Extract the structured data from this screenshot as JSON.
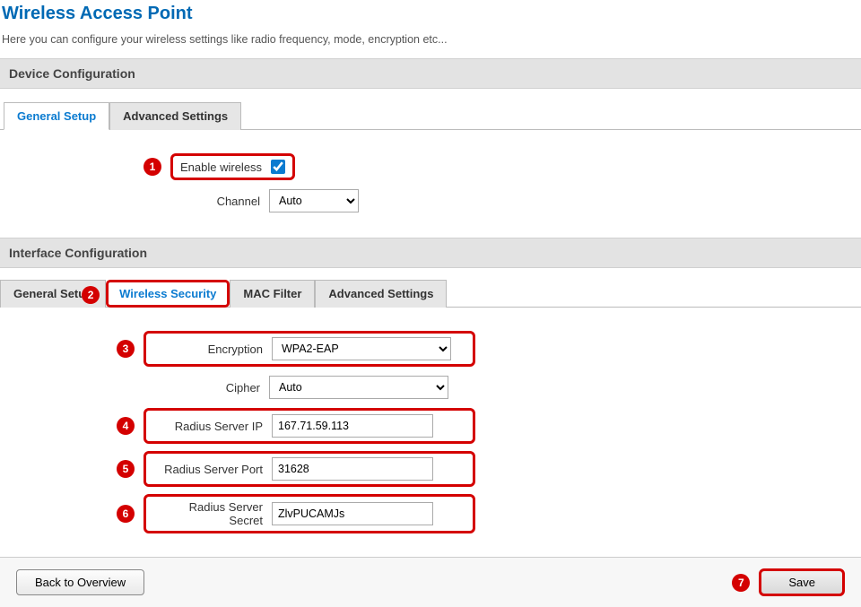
{
  "page": {
    "title": "Wireless Access Point",
    "desc": "Here you can configure your wireless settings like radio frequency, mode, encryption etc..."
  },
  "deviceConfig": {
    "header": "Device Configuration",
    "tabs": {
      "general": "General Setup",
      "advanced": "Advanced Settings"
    },
    "enableWireless": {
      "label": "Enable wireless"
    },
    "channel": {
      "label": "Channel",
      "value": "Auto"
    }
  },
  "interfaceConfig": {
    "header": "Interface Configuration",
    "tabs": {
      "general": "General Setup",
      "security": "Wireless Security",
      "mac": "MAC Filter",
      "advanced": "Advanced Settings"
    },
    "encryption": {
      "label": "Encryption",
      "value": "WPA2-EAP"
    },
    "cipher": {
      "label": "Cipher",
      "value": "Auto"
    },
    "radiusIp": {
      "label": "Radius Server IP",
      "value": "167.71.59.113"
    },
    "radiusPort": {
      "label": "Radius Server Port",
      "value": "31628"
    },
    "radiusSecret": {
      "label": "Radius Server Secret",
      "value": "ZlvPUCAMJs"
    }
  },
  "footer": {
    "back": "Back to Overview",
    "save": "Save"
  },
  "callouts": {
    "c1": "1",
    "c2": "2",
    "c3": "3",
    "c4": "4",
    "c5": "5",
    "c6": "6",
    "c7": "7"
  }
}
